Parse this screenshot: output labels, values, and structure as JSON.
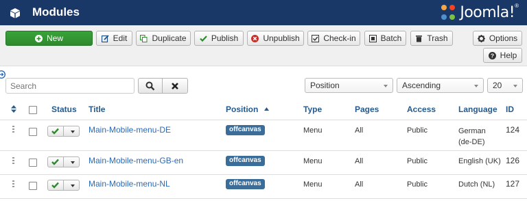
{
  "header": {
    "title": "Modules",
    "brand": "Joomla!",
    "brand_mark": "®"
  },
  "toolbar": {
    "new": "New",
    "edit": "Edit",
    "duplicate": "Duplicate",
    "publish": "Publish",
    "unpublish": "Unpublish",
    "checkin": "Check-in",
    "batch": "Batch",
    "trash": "Trash",
    "options": "Options",
    "help": "Help"
  },
  "filters": {
    "search_placeholder": "Search",
    "order_by": "Position",
    "direction": "Ascending",
    "limit": "20"
  },
  "table": {
    "headers": {
      "status": "Status",
      "title": "Title",
      "position": "Position",
      "type": "Type",
      "pages": "Pages",
      "access": "Access",
      "language": "Language",
      "id": "ID"
    },
    "rows": [
      {
        "title": "Main-Mobile-menu-DE",
        "position": "offcanvas",
        "type": "Menu",
        "pages": "All",
        "access": "Public",
        "language": "German",
        "language_code": "(de-DE)",
        "id": "124"
      },
      {
        "title": "Main-Mobile-menu-GB-en",
        "position": "offcanvas",
        "type": "Menu",
        "pages": "All",
        "access": "Public",
        "language": "English (UK)",
        "id": "126"
      },
      {
        "title": "Main-Mobile-menu-NL",
        "position": "offcanvas",
        "type": "Menu",
        "pages": "All",
        "access": "Public",
        "language": "Dutch (NL)",
        "id": "127"
      }
    ]
  },
  "colors": {
    "header_bg": "#1a3867",
    "new_button": "#2e8a2e",
    "link": "#2a69b8",
    "badge": "#3a6d99"
  }
}
